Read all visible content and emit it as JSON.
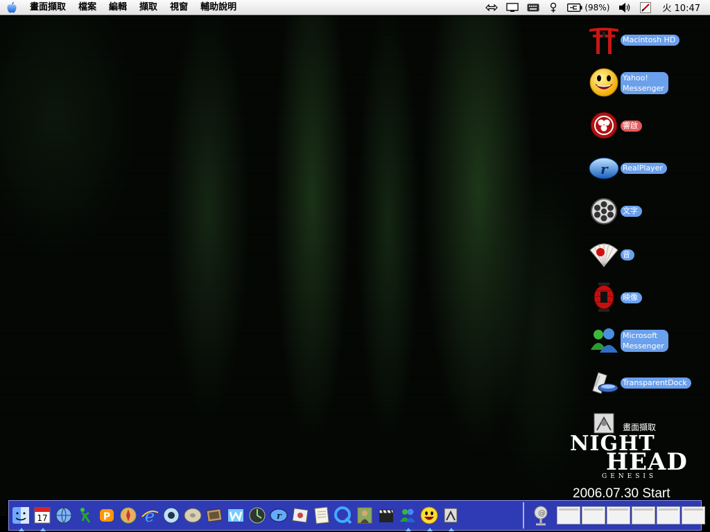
{
  "menubar": {
    "items": [
      "畫面擷取",
      "檔案",
      "編輯",
      "擷取",
      "視窗",
      "輔助說明"
    ],
    "battery": "(98%)",
    "clock": "火 10:47"
  },
  "desktop_icons": [
    {
      "label": "Macintosh HD",
      "icon": "torii-gate-icon"
    },
    {
      "label": "Yahoo!\nMessenger",
      "icon": "yahoo-smiley-icon"
    },
    {
      "label": "響啟",
      "icon": "red-crest-icon"
    },
    {
      "label": "RealPlayer",
      "icon": "realplayer-icon"
    },
    {
      "label": "文字",
      "icon": "film-reel-icon"
    },
    {
      "label": "音",
      "icon": "folding-fan-icon"
    },
    {
      "label": "映像",
      "icon": "red-lantern-icon"
    },
    {
      "label": "Microsoft\nMessenger",
      "icon": "msn-buddies-icon"
    },
    {
      "label": "TransparentDock",
      "icon": "transparent-dock-icon"
    },
    {
      "label": "畫面擷取",
      "icon": "screen-capture-icon"
    }
  ],
  "poster": {
    "line1": "NIGHT",
    "line2": "HEAD",
    "genesis": "GENESIS",
    "start": "2006.07.30 Start"
  },
  "dock": {
    "apps": [
      "finder-icon",
      "ical-icon",
      "network-globe-icon",
      "ichat-runner-icon",
      "app-p-icon",
      "safari-compass-icon",
      "internet-explorer-icon",
      "itunes-eye-icon",
      "disk-utility-icon",
      "iphoto-icon",
      "app-w-icon",
      "dashboard-icon",
      "realplayer-icon",
      "photo-tool-icon",
      "chart-paper-icon",
      "quicktime-icon",
      "mona-lisa-icon",
      "imovie-clapper-icon",
      "msn-messenger-icon",
      "yahoo-messenger-icon",
      "screen-capture-icon"
    ],
    "running": [
      0,
      1,
      18,
      19,
      20
    ],
    "calendar_day": "17",
    "minimized_count": 6
  }
}
